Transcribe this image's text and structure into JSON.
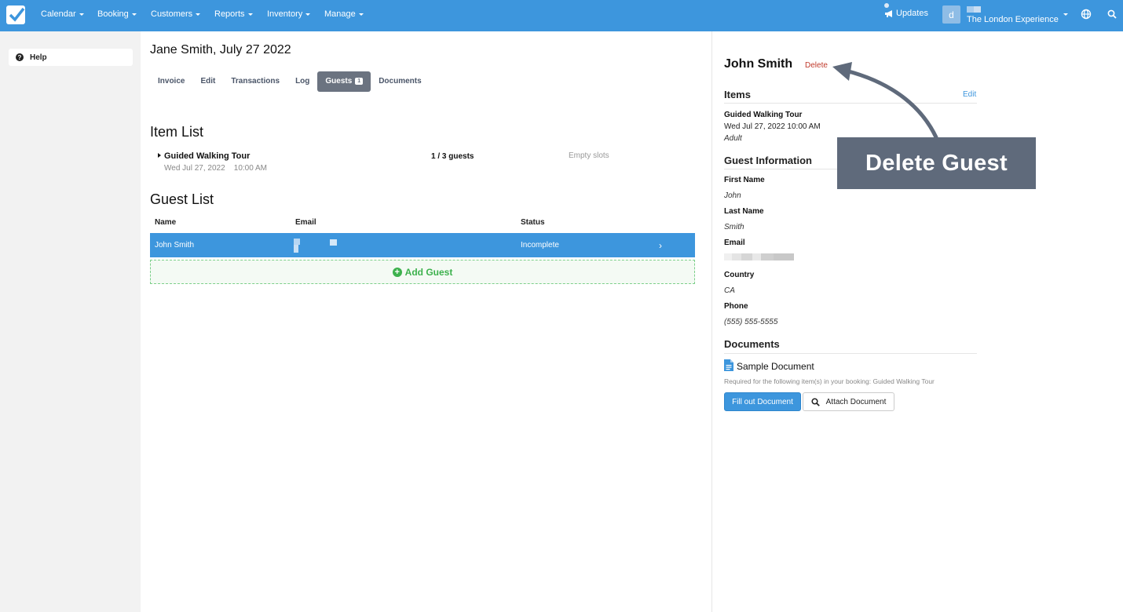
{
  "nav": {
    "items": [
      {
        "label": "Calendar"
      },
      {
        "label": "Booking"
      },
      {
        "label": "Customers"
      },
      {
        "label": "Reports"
      },
      {
        "label": "Inventory"
      },
      {
        "label": "Manage"
      }
    ],
    "updates_label": "Updates",
    "avatar_letter": "d",
    "account_name": "The London Experience",
    "brand_color": "#3d96dd"
  },
  "sidebar": {
    "help_label": "Help"
  },
  "booking": {
    "title": "Jane Smith, July 27 2022",
    "tabs": [
      {
        "label": "Invoice"
      },
      {
        "label": "Edit"
      },
      {
        "label": "Transactions"
      },
      {
        "label": "Log"
      },
      {
        "label": "Guests",
        "badge": "1",
        "active": true
      },
      {
        "label": "Documents"
      }
    ]
  },
  "item_list": {
    "heading": "Item List",
    "items": [
      {
        "name": "Guided Walking Tour",
        "date": "Wed Jul 27, 2022    10:00 AM",
        "guests": "1 / 3 guests",
        "slots": "Empty slots"
      }
    ]
  },
  "guest_list": {
    "heading": "Guest List",
    "columns": [
      "Name",
      "Email",
      "Status"
    ],
    "rows": [
      {
        "name": "John Smith",
        "email": "",
        "status": "Incomplete"
      }
    ],
    "add_label": "Add Guest"
  },
  "guest_detail": {
    "name": "John Smith",
    "delete_label": "Delete",
    "items_heading": "Items",
    "edit_label": "Edit",
    "item_name": "Guided Walking Tour",
    "item_datetime": "Wed Jul 27, 2022 10:00 AM",
    "item_type": "Adult",
    "info_heading": "Guest Information",
    "fields": [
      {
        "label": "First Name",
        "value": "John"
      },
      {
        "label": "Last Name",
        "value": "Smith"
      },
      {
        "label": "Email",
        "value": ""
      },
      {
        "label": "Country",
        "value": "CA"
      },
      {
        "label": "Phone",
        "value": "(555) 555-5555"
      }
    ],
    "documents_heading": "Documents",
    "document_name": "Sample Document",
    "document_requirement": "Required for the following item(s) in your booking: Guided Walking Tour",
    "fill_button": "Fill out Document",
    "attach_button": "Attach Document"
  },
  "annotation": {
    "label": "Delete Guest"
  }
}
